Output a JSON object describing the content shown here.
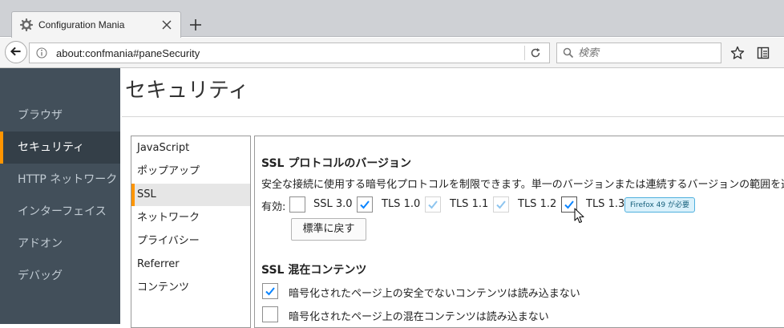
{
  "browser": {
    "tab_title": "Configuration Mania",
    "url": "about:confmania#paneSecurity",
    "search_placeholder": "検索"
  },
  "sidebar": {
    "items": [
      {
        "label": "ブラウザ",
        "selected": false
      },
      {
        "label": "セキュリティ",
        "selected": true
      },
      {
        "label": "HTTP ネットワーク",
        "selected": false
      },
      {
        "label": "インターフェイス",
        "selected": false
      },
      {
        "label": "アドオン",
        "selected": false
      },
      {
        "label": "デバッグ",
        "selected": false
      }
    ],
    "accent_color": "#ff9500"
  },
  "page": {
    "title": "セキュリティ"
  },
  "subnav": {
    "items": [
      {
        "label": "JavaScript",
        "selected": false
      },
      {
        "label": "ポップアップ",
        "selected": false
      },
      {
        "label": "SSL",
        "selected": true
      },
      {
        "label": "ネットワーク",
        "selected": false
      },
      {
        "label": "プライバシー",
        "selected": false
      },
      {
        "label": "Referrer",
        "selected": false
      },
      {
        "label": "コンテンツ",
        "selected": false
      }
    ]
  },
  "ssl_protocol": {
    "title": "SSL プロトコルのバージョン",
    "description": "安全な接続に使用する暗号化プロトコルを制限できます。単一のバージョンまたは連続するバージョンの範囲を選択",
    "enabled_label": "有効:",
    "versions": [
      {
        "label": "SSL 3.0",
        "checked": false,
        "disabled": false
      },
      {
        "label": "TLS 1.0",
        "checked": true,
        "disabled": false
      },
      {
        "label": "TLS 1.1",
        "checked": true,
        "disabled": true
      },
      {
        "label": "TLS 1.2",
        "checked": true,
        "disabled": true
      },
      {
        "label": "TLS 1.3",
        "checked": true,
        "disabled": false
      }
    ],
    "reset_label": "標準に戻す",
    "tooltip": "Firefox 49 が必要"
  },
  "mixed_content": {
    "title": "SSL 混在コンテンツ",
    "options": [
      {
        "label": "暗号化されたページ上の安全でないコンテンツは読み込まない",
        "checked": true
      },
      {
        "label": "暗号化されたページ上の混在コンテンツは読み込まない",
        "checked": false
      }
    ]
  },
  "icons": {
    "tab": "gear-icon",
    "tab_close": "close-icon",
    "new_tab": "plus-icon",
    "back": "back-arrow-icon",
    "site_info": "info-icon",
    "reload": "reload-icon",
    "search": "search-icon",
    "bookmark": "star-icon",
    "library": "library-icon",
    "cursor": "mouse-pointer-icon"
  }
}
